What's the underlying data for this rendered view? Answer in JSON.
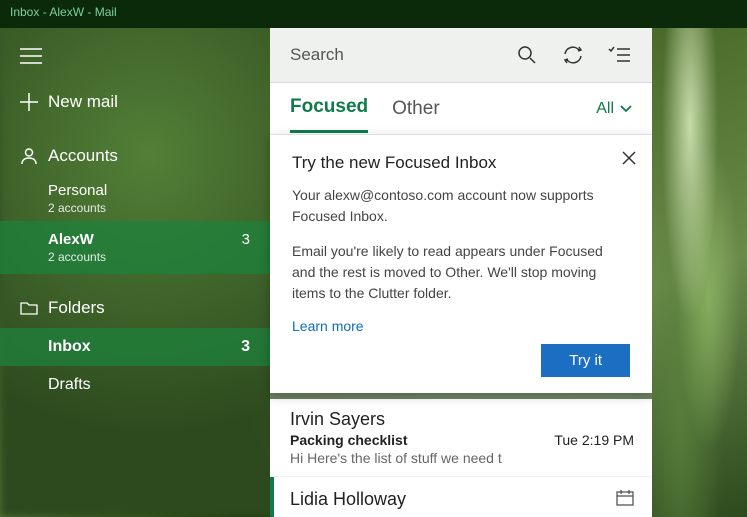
{
  "window": {
    "title": "Inbox - AlexW - Mail"
  },
  "sidebar": {
    "new_mail": "New mail",
    "accounts_label": "Accounts",
    "accounts": [
      {
        "name": "Personal",
        "sub": "2 accounts",
        "count": "",
        "selected": false
      },
      {
        "name": "AlexW",
        "sub": "2 accounts",
        "count": "3",
        "selected": true
      }
    ],
    "folders_label": "Folders",
    "folders": [
      {
        "name": "Inbox",
        "count": "3",
        "selected": true
      },
      {
        "name": "Drafts",
        "count": "",
        "selected": false
      }
    ]
  },
  "toolbar": {
    "search_placeholder": "Search"
  },
  "tabs": {
    "focused": "Focused",
    "other": "Other",
    "filter": "All"
  },
  "popup": {
    "title": "Try the new Focused Inbox",
    "line1": "Your alexw@contoso.com account now supports Focused Inbox.",
    "line2": "Email you're likely to read appears under Focused and the rest is moved to Other. We'll stop moving items to the Clutter folder.",
    "link": "Learn more",
    "cta": "Try it"
  },
  "messages": [
    {
      "sender": "Irvin Sayers",
      "subject": "Packing checklist",
      "time": "Tue 2:19 PM",
      "preview": "Hi Here's the list of stuff we need t",
      "accent": false,
      "has_calendar": false
    },
    {
      "sender": "Lidia Holloway",
      "subject": "",
      "time": "",
      "preview": "",
      "accent": true,
      "has_calendar": true
    }
  ]
}
